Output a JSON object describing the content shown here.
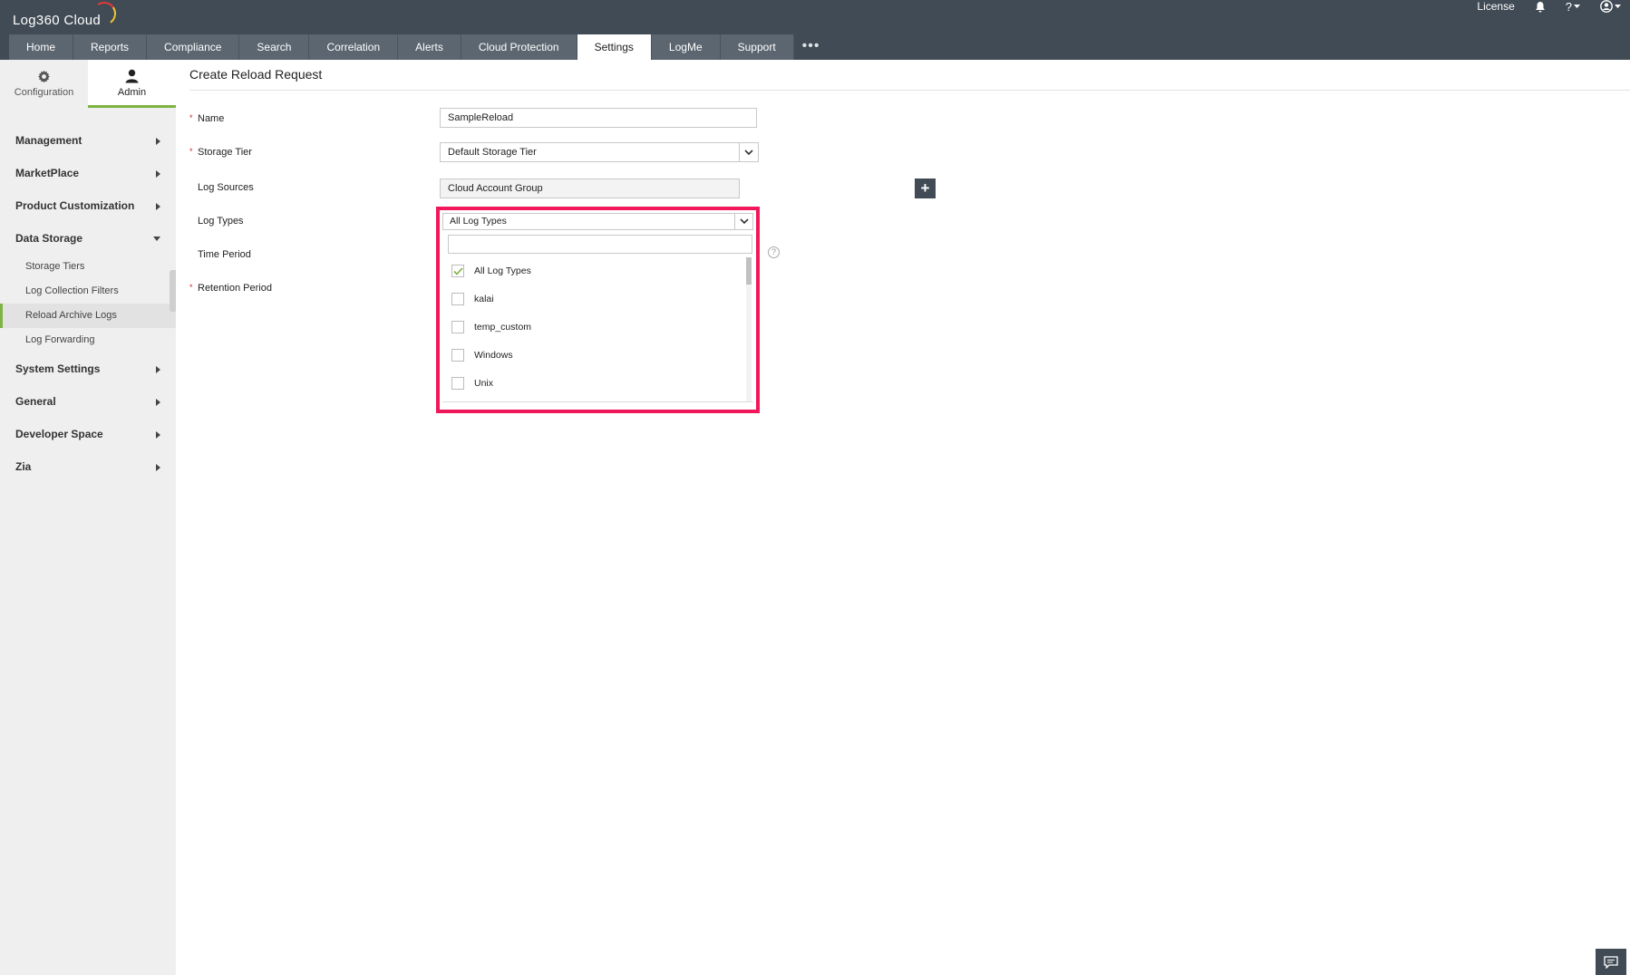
{
  "app": {
    "logo_text": "Log360 Cloud"
  },
  "top_bar": {
    "license_label": "License",
    "help_label": "?"
  },
  "tabs": [
    {
      "label": "Home"
    },
    {
      "label": "Reports"
    },
    {
      "label": "Compliance"
    },
    {
      "label": "Search"
    },
    {
      "label": "Correlation"
    },
    {
      "label": "Alerts"
    },
    {
      "label": "Cloud Protection"
    },
    {
      "label": "Settings",
      "active": true
    },
    {
      "label": "LogMe"
    },
    {
      "label": "Support"
    }
  ],
  "tabs_more": "•••",
  "sidebar": {
    "tabs": [
      {
        "label": "Configuration",
        "icon": "gear-icon"
      },
      {
        "label": "Admin",
        "icon": "user-icon",
        "active": true
      }
    ],
    "menu": [
      {
        "label": "Management"
      },
      {
        "label": "MarketPlace"
      },
      {
        "label": "Product Customization"
      },
      {
        "label": "Data Storage",
        "expanded": true,
        "children": [
          "Storage Tiers",
          "Log Collection Filters",
          "Reload Archive Logs",
          "Log Forwarding"
        ],
        "active_child": "Reload Archive Logs"
      },
      {
        "label": "System Settings"
      },
      {
        "label": "General"
      },
      {
        "label": "Developer Space"
      },
      {
        "label": "Zia"
      }
    ]
  },
  "form": {
    "title": "Create Reload Request",
    "required_marker": "*",
    "name": {
      "label": "Name",
      "value": "SampleReload"
    },
    "storage_tier": {
      "label": "Storage Tier",
      "value": "Default Storage Tier"
    },
    "log_sources": {
      "label": "Log Sources",
      "value": "Cloud Account Group",
      "add_icon": "plus-icon"
    },
    "log_types": {
      "label": "Log Types",
      "value": "All Log Types",
      "search_value": "",
      "options": [
        {
          "label": "All Log Types",
          "checked": true
        },
        {
          "label": "kalai",
          "checked": false
        },
        {
          "label": "temp_custom",
          "checked": false
        },
        {
          "label": "Windows",
          "checked": false
        },
        {
          "label": "Unix",
          "checked": false
        }
      ],
      "highlight_color": "#f0185b"
    },
    "time_period": {
      "label": "Time Period",
      "help": "?"
    },
    "retention_period": {
      "label": "Retention Period"
    }
  },
  "colors": {
    "header": "#404b55",
    "accent": "#7cb342",
    "highlight": "#f0185b"
  }
}
